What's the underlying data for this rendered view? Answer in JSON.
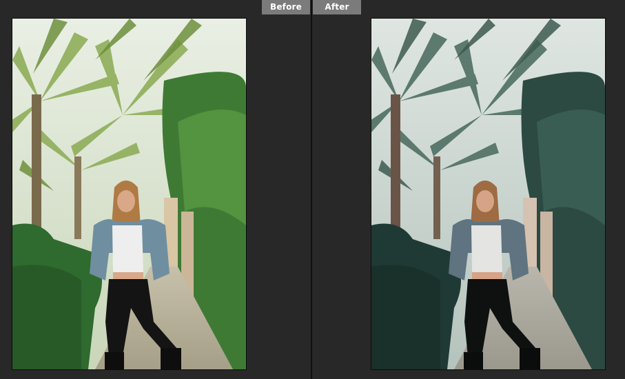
{
  "tabs": {
    "before_label": "Before",
    "after_label": "After"
  },
  "colors": {
    "background": "#262626",
    "tab_bg": "#7b7b7b",
    "tab_text": "#ffffff",
    "divider": "#101010"
  }
}
